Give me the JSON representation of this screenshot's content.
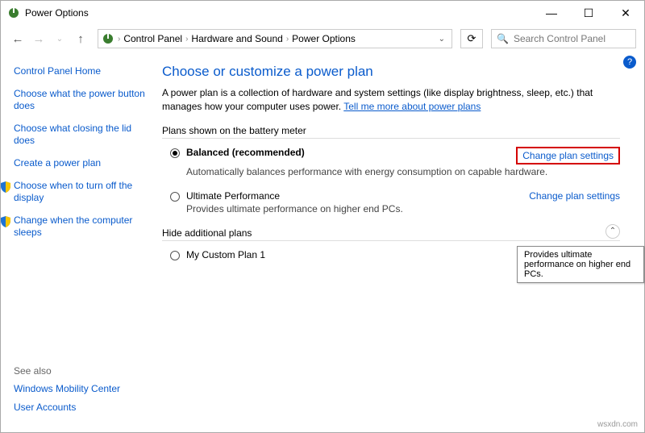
{
  "window": {
    "title": "Power Options"
  },
  "toolbar": {
    "breadcrumb": [
      "Control Panel",
      "Hardware and Sound",
      "Power Options"
    ],
    "search_placeholder": "Search Control Panel"
  },
  "sidebar": {
    "home": "Control Panel Home",
    "links": [
      "Choose what the power button does",
      "Choose what closing the lid does",
      "Create a power plan",
      "Choose when to turn off the display",
      "Change when the computer sleeps"
    ],
    "see_also_label": "See also",
    "see_also": [
      "Windows Mobility Center",
      "User Accounts"
    ]
  },
  "main": {
    "heading": "Choose or customize a power plan",
    "description": "A power plan is a collection of hardware and system settings (like display brightness, sleep, etc.) that manages how your computer uses power.",
    "learn_more": "Tell me more about power plans",
    "section1": "Plans shown on the battery meter",
    "section2": "Hide additional plans",
    "change_label": "Change plan settings",
    "plans": [
      {
        "name": "Balanced (recommended)",
        "sub": "Automatically balances performance with energy consumption on capable hardware.",
        "checked": true,
        "highlight": true
      },
      {
        "name": "Ultimate Performance",
        "sub": "Provides ultimate performance on higher end PCs.",
        "checked": false,
        "highlight": false
      }
    ],
    "extra_plan": {
      "name": "My Custom Plan 1"
    },
    "tooltip": "Provides ultimate performance on higher end PCs."
  },
  "watermark": "wsxdn.com"
}
